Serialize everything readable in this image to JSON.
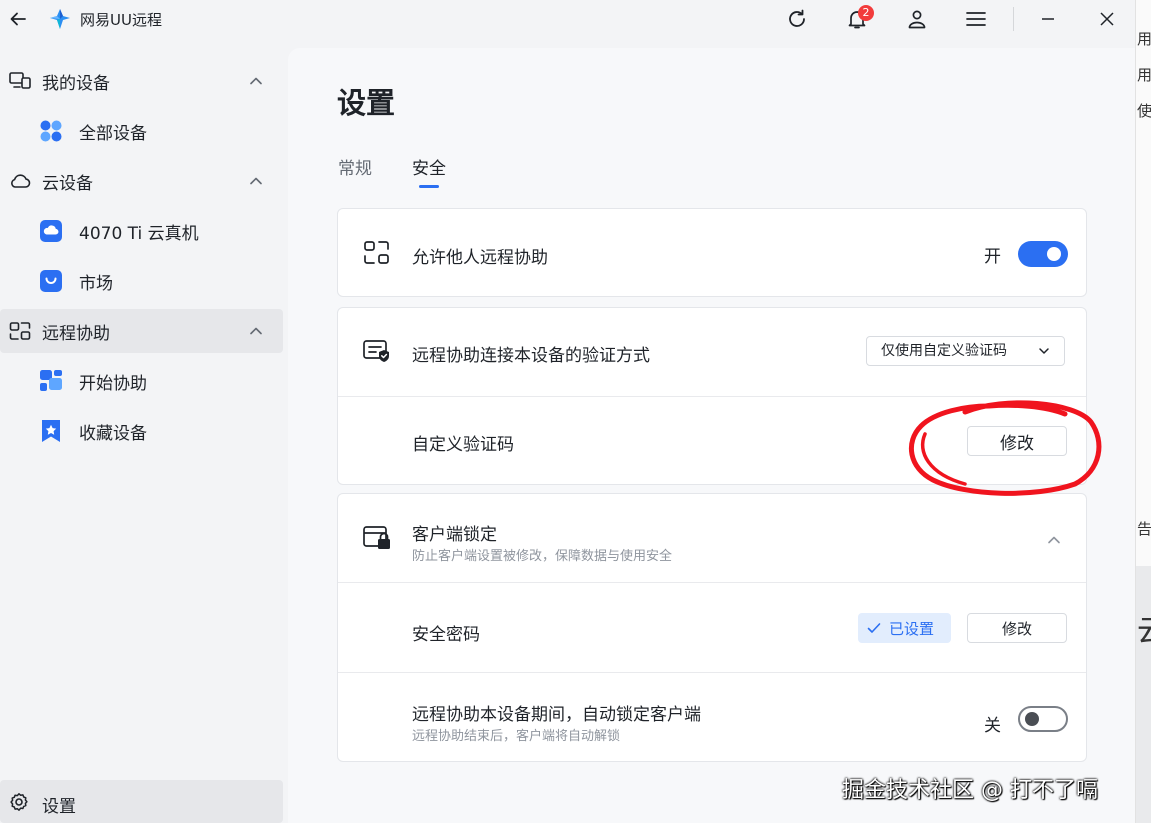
{
  "app": {
    "title": "网易UU远程",
    "notification_count": "2"
  },
  "sidebar": {
    "groups": [
      {
        "label": "我的设备",
        "items": [
          {
            "label": "全部设备"
          }
        ]
      },
      {
        "label": "云设备",
        "items": [
          {
            "label": "4070 Ti 云真机"
          },
          {
            "label": "市场"
          }
        ]
      },
      {
        "label": "远程协助",
        "items": [
          {
            "label": "开始协助"
          },
          {
            "label": "收藏设备"
          }
        ]
      }
    ],
    "settings_label": "设置"
  },
  "page": {
    "title": "设置",
    "tabs": [
      {
        "label": "常规"
      },
      {
        "label": "安全",
        "active": true
      }
    ]
  },
  "security": {
    "allow_remote": {
      "label": "允许他人远程协助",
      "state_text": "开",
      "enabled": true
    },
    "verify_method": {
      "label": "远程协助连接本设备的验证方式",
      "selected": "仅使用自定义验证码"
    },
    "custom_code": {
      "label": "自定义验证码",
      "button": "修改"
    },
    "client_lock": {
      "title": "客户端锁定",
      "subtitle": "防止客户端设置被修改，保障数据与使用安全"
    },
    "security_password": {
      "label": "安全密码",
      "status": "已设置",
      "button": "修改"
    },
    "auto_lock": {
      "title": "远程协助本设备期间，自动锁定客户端",
      "subtitle": "远程协助结束后，客户端将自动解锁",
      "state_text": "关",
      "enabled": false
    }
  },
  "background_window": {
    "fragments": [
      "用",
      "用",
      "使",
      "告",
      "云"
    ]
  },
  "watermark": "掘金技术社区 @ 打不了嗝",
  "colors": {
    "accent": "#2b6ff2",
    "annotation": "#f0141e",
    "badge": "#f23c3c"
  }
}
